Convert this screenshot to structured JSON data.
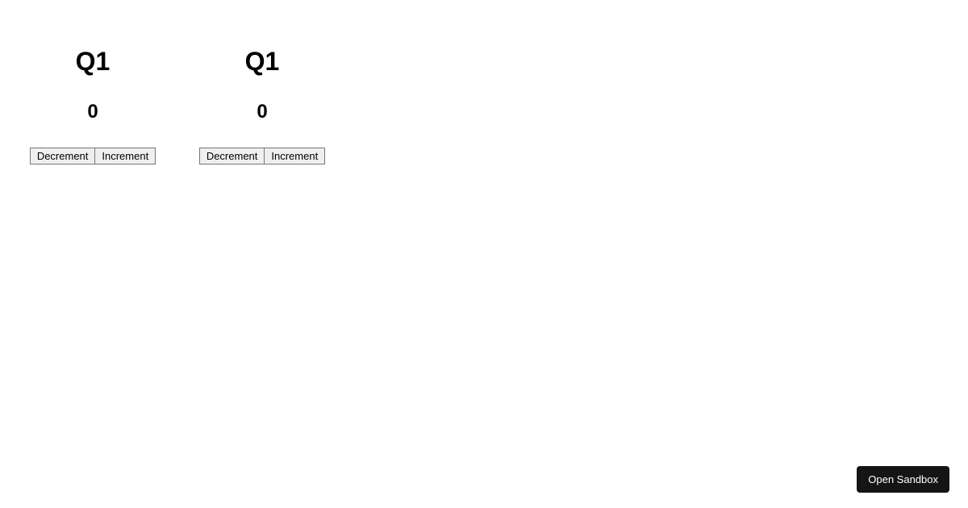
{
  "counters": [
    {
      "title": "Q1",
      "value": "0",
      "decrement_label": "Decrement",
      "increment_label": "Increment"
    },
    {
      "title": "Q1",
      "value": "0",
      "decrement_label": "Decrement",
      "increment_label": "Increment"
    }
  ],
  "sandbox_button_label": "Open Sandbox"
}
